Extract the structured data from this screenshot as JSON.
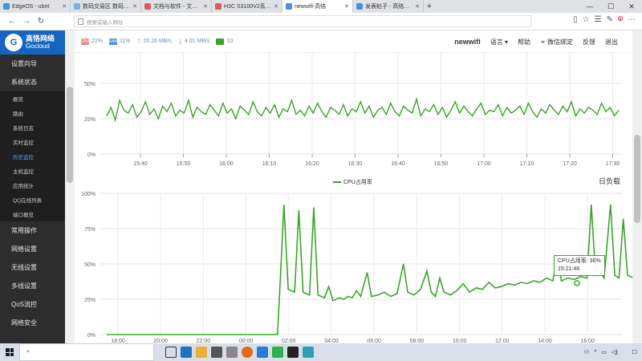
{
  "browser": {
    "tabs": [
      {
        "label": "EdgeOS - ubnt",
        "color": "#4a90d9",
        "active": false
      },
      {
        "label": "数码交易区 数码之家",
        "color": "#6fb1e8",
        "active": false
      },
      {
        "label": "文档与软件 - 文档与软件 - 数",
        "color": "#e05a5a",
        "active": false
      },
      {
        "label": "H3C S3100V2系列以太网交",
        "color": "#e05a5a",
        "active": false
      },
      {
        "label": "newwifi-高恪",
        "color": "#4a90d9",
        "active": true
      },
      {
        "label": "发表帖子 - 高恪技术直通车",
        "color": "#4a90d9",
        "active": false
      }
    ],
    "new_tab": "+",
    "win_minimize": "—",
    "win_maximize": "☐",
    "win_close": "✕",
    "back": "←",
    "forward": "→",
    "reload": "↻",
    "url_placeholder": "搜索或输入网址",
    "btn_reading": "▯",
    "btn_favorite": "☆",
    "btn_collections": "☰",
    "btn_share": "✎",
    "btn_profile": "⌾",
    "btn_more": "···"
  },
  "sidebar": {
    "logo_mark": "G",
    "brand_cn": "高恪网络",
    "brand_en": "Gocloud",
    "menu": [
      {
        "label": "设置向导"
      },
      {
        "label": "系统状态"
      }
    ],
    "submenu": [
      {
        "label": "概览",
        "active": false
      },
      {
        "label": "路由",
        "active": false
      },
      {
        "label": "系统日志",
        "active": false
      },
      {
        "label": "实时监控",
        "active": false
      },
      {
        "label": "历史监控",
        "active": true
      },
      {
        "label": "主机监控",
        "active": false
      },
      {
        "label": "应用统计",
        "active": false
      },
      {
        "label": "QQ在线列表",
        "active": false
      },
      {
        "label": "端口概览",
        "active": false
      }
    ],
    "menu_after": [
      {
        "label": "常用操作"
      },
      {
        "label": "网络设置"
      },
      {
        "label": "无线设置"
      },
      {
        "label": "多线设置"
      },
      {
        "label": "QoS流控"
      },
      {
        "label": "网络安全"
      }
    ]
  },
  "header": {
    "cpu_icon": "CPU",
    "cpu_value": "22%",
    "ram_icon": "RAM",
    "ram_value": "11%",
    "upload_value": "20.26 MB/s",
    "download_value": "4.01 MB/s",
    "online_value": "10",
    "brand": "newwifi",
    "language": "语言 ▾",
    "help": "帮助",
    "wechat_bind": "微信绑定",
    "feedback": "反馈",
    "logout": "退出"
  },
  "colors": {
    "series": "#3aa52a",
    "sidebar_bg": "#2d2d2d",
    "logo_bg": "#1565c0",
    "active_item": "#4da3ff"
  },
  "day_title": "日负载",
  "tooltip": {
    "label": "CPU占用率: 36%",
    "time": "15:21:46"
  },
  "chart_data": [
    {
      "type": "line",
      "ylim": [
        0,
        50
      ],
      "yticks": [
        "0%",
        "25%",
        "50%"
      ],
      "xticks": [
        "15:40",
        "15:50",
        "16:00",
        "16:10",
        "16:20",
        "16:30",
        "16:40",
        "16:50",
        "17:00",
        "17:10",
        "17:20",
        "17:30"
      ],
      "series": [
        {
          "values": [
            27,
            33,
            24,
            38,
            31,
            29,
            35,
            26,
            30,
            37,
            28,
            32,
            25,
            34,
            30,
            36,
            27,
            31,
            29,
            38,
            26,
            33,
            30,
            28,
            35,
            31,
            27,
            36,
            29,
            32,
            25,
            34,
            31,
            28,
            37,
            30,
            27,
            33,
            29,
            35,
            26,
            32,
            30,
            38,
            28,
            31,
            27,
            34,
            29,
            36,
            30,
            26,
            33,
            31,
            28,
            35,
            27,
            32,
            30,
            37,
            29,
            34,
            26,
            31,
            33,
            28,
            36,
            30,
            27,
            34,
            31,
            29,
            39,
            27,
            32,
            30,
            35,
            28,
            33,
            26,
            31,
            37,
            29,
            34,
            30,
            27,
            32,
            36,
            28,
            31,
            30,
            35,
            27,
            33,
            29,
            31,
            34,
            28,
            36,
            30,
            26,
            32,
            29,
            35,
            31,
            28,
            34,
            30,
            37,
            27,
            32,
            29,
            33,
            31,
            28,
            36,
            30,
            33,
            27,
            31
          ]
        }
      ]
    },
    {
      "type": "line",
      "ylim": [
        0,
        100
      ],
      "yticks": [
        "0%",
        "25%",
        "50%",
        "75%",
        "100%"
      ],
      "xticks": [
        "18:00",
        "20:00",
        "22:00",
        "00:00",
        "02:00",
        "04:00",
        "06:00",
        "08:00",
        "10:00",
        "12:00",
        "14:00",
        "16:00"
      ],
      "series": [
        {
          "name": "CPU占用率",
          "points": [
            [
              0,
              0
            ],
            [
              2,
              0
            ],
            [
              4,
              0
            ],
            [
              6,
              0
            ],
            [
              8,
              0
            ],
            [
              8.1,
              30
            ],
            [
              8.3,
              92
            ],
            [
              8.5,
              32
            ],
            [
              8.8,
              30
            ],
            [
              9.0,
              88
            ],
            [
              9.2,
              30
            ],
            [
              9.5,
              28
            ],
            [
              9.7,
              90
            ],
            [
              9.9,
              28
            ],
            [
              10.2,
              26
            ],
            [
              10.4,
              34
            ],
            [
              10.6,
              24
            ],
            [
              10.9,
              26
            ],
            [
              11.1,
              25
            ],
            [
              11.3,
              27
            ],
            [
              11.5,
              26
            ],
            [
              11.7,
              31
            ],
            [
              11.9,
              27
            ],
            [
              12.2,
              44
            ],
            [
              12.4,
              27
            ],
            [
              12.7,
              28
            ],
            [
              13.0,
              30
            ],
            [
              13.3,
              27
            ],
            [
              13.6,
              29
            ],
            [
              13.9,
              50
            ],
            [
              14.1,
              30
            ],
            [
              14.4,
              28
            ],
            [
              14.7,
              32
            ],
            [
              15.0,
              45
            ],
            [
              15.2,
              30
            ],
            [
              15.4,
              27
            ],
            [
              15.6,
              40
            ],
            [
              15.8,
              30
            ],
            [
              16.1,
              28
            ],
            [
              16.4,
              31
            ],
            [
              16.7,
              36
            ],
            [
              17.0,
              30
            ],
            [
              17.3,
              33
            ],
            [
              17.6,
              32
            ],
            [
              17.9,
              37
            ],
            [
              18.2,
              33
            ],
            [
              18.5,
              34
            ],
            [
              18.8,
              36
            ],
            [
              19.1,
              35
            ],
            [
              19.4,
              37
            ],
            [
              19.7,
              36
            ],
            [
              20.0,
              38
            ],
            [
              20.3,
              37
            ],
            [
              20.6,
              40
            ],
            [
              20.9,
              38
            ],
            [
              21.1,
              55
            ],
            [
              21.3,
              38
            ],
            [
              21.6,
              40
            ],
            [
              21.9,
              39
            ],
            [
              22.2,
              41
            ],
            [
              22.5,
              40
            ],
            [
              22.7,
              92
            ],
            [
              22.9,
              42
            ],
            [
              23.1,
              45
            ],
            [
              23.3,
              40
            ],
            [
              23.6,
              92
            ],
            [
              23.8,
              42
            ],
            [
              24.0,
              40
            ],
            [
              24.2,
              82
            ],
            [
              24.4,
              42
            ],
            [
              24.7,
              40
            ],
            [
              25.0,
              45
            ],
            [
              25.2,
              40
            ],
            [
              25.4,
              90
            ],
            [
              25.6,
              40
            ],
            [
              25.9,
              38
            ],
            [
              26.2,
              42
            ],
            [
              26.5,
              40
            ],
            [
              26.8,
              38
            ],
            [
              27.1,
              41
            ],
            [
              27.4,
              39
            ],
            [
              27.7,
              40
            ],
            [
              28.0,
              39
            ]
          ]
        }
      ]
    }
  ]
}
